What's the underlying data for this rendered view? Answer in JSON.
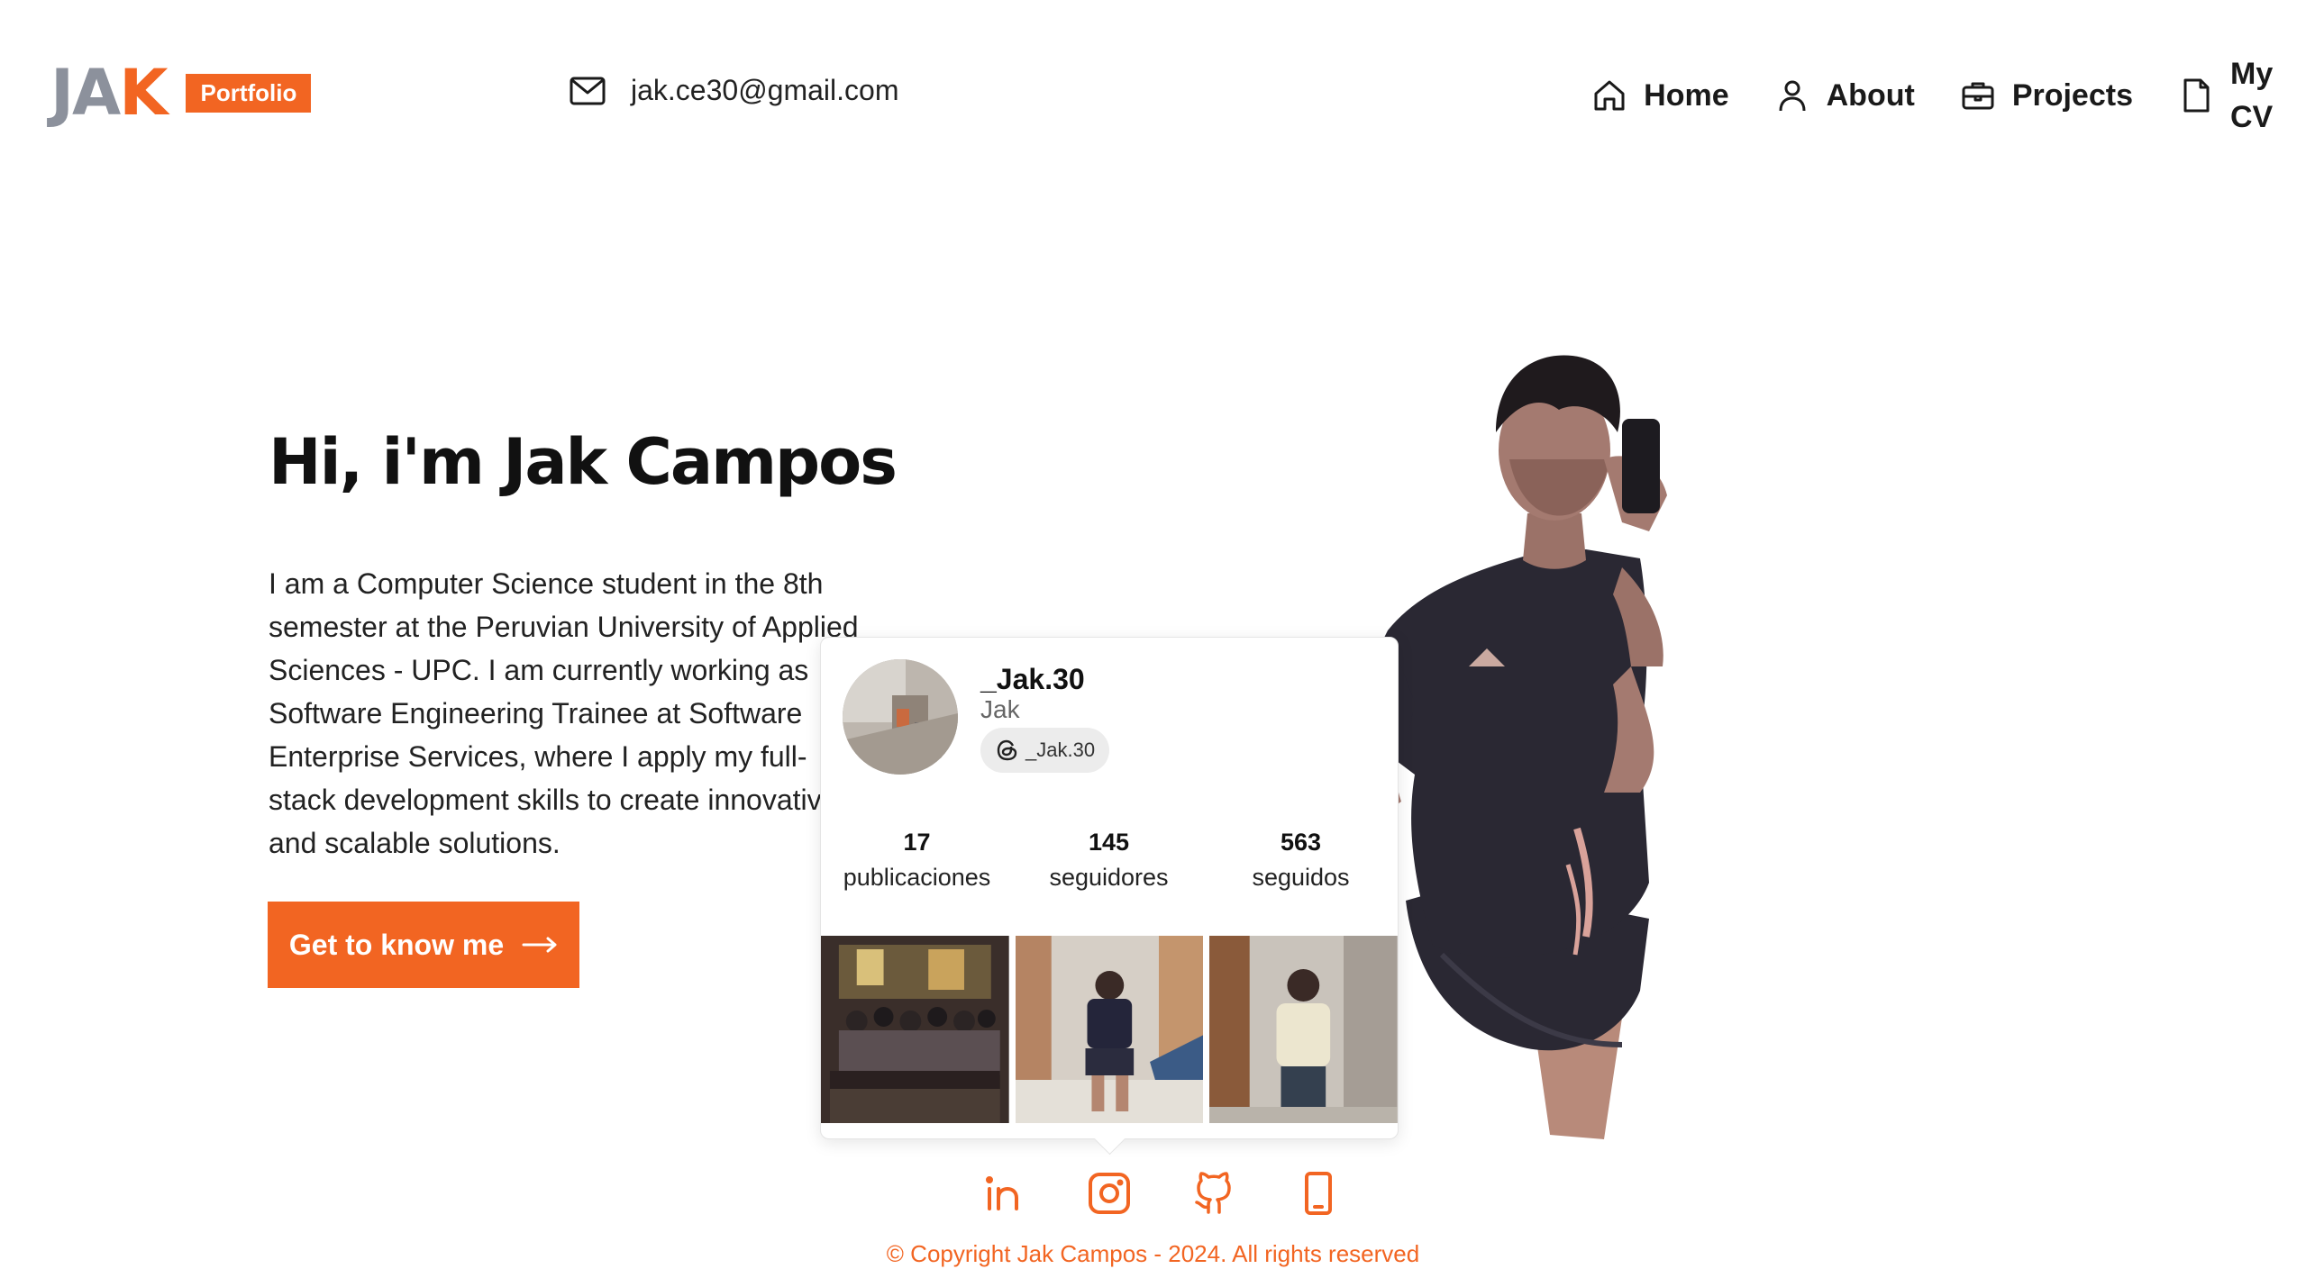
{
  "brand": {
    "logo_part1": "JA",
    "logo_part2": "K",
    "badge": "Portfolio"
  },
  "contact": {
    "email": "jak.ce30@gmail.com"
  },
  "nav": {
    "items": [
      {
        "label": "Home",
        "icon": "home-icon"
      },
      {
        "label": "About",
        "icon": "user-icon"
      },
      {
        "label": "Projects",
        "icon": "briefcase-icon"
      },
      {
        "label": "My CV",
        "icon": "document-icon"
      }
    ]
  },
  "hero": {
    "title": "Hi, i'm Jak Campos",
    "description": "I am a Computer Science student in the 8th semester at the Peruvian University of Applied Sciences - UPC. I am currently working as Software Engineering Trainee at Software Enterprise Services, where I apply my full-stack development skills to create innovative and scalable solutions.",
    "cta_label": "Get to know me",
    "cta_icon": "arrow-right-icon"
  },
  "instagram_card": {
    "username": "_Jak.30",
    "name": "Jak",
    "threads_handle": "_Jak.30",
    "stats": [
      {
        "value": "17",
        "label": "publicaciones"
      },
      {
        "value": "145",
        "label": "seguidores"
      },
      {
        "value": "563",
        "label": "seguidos"
      }
    ]
  },
  "social": [
    "linkedin-icon",
    "instagram-icon",
    "github-icon",
    "phone-icon"
  ],
  "footer": {
    "copyright": "© Copyright Jak Campos - 2024. All rights reserved"
  },
  "colors": {
    "accent": "#f26522",
    "logo_gray": "#8c919c",
    "text": "#111111"
  }
}
